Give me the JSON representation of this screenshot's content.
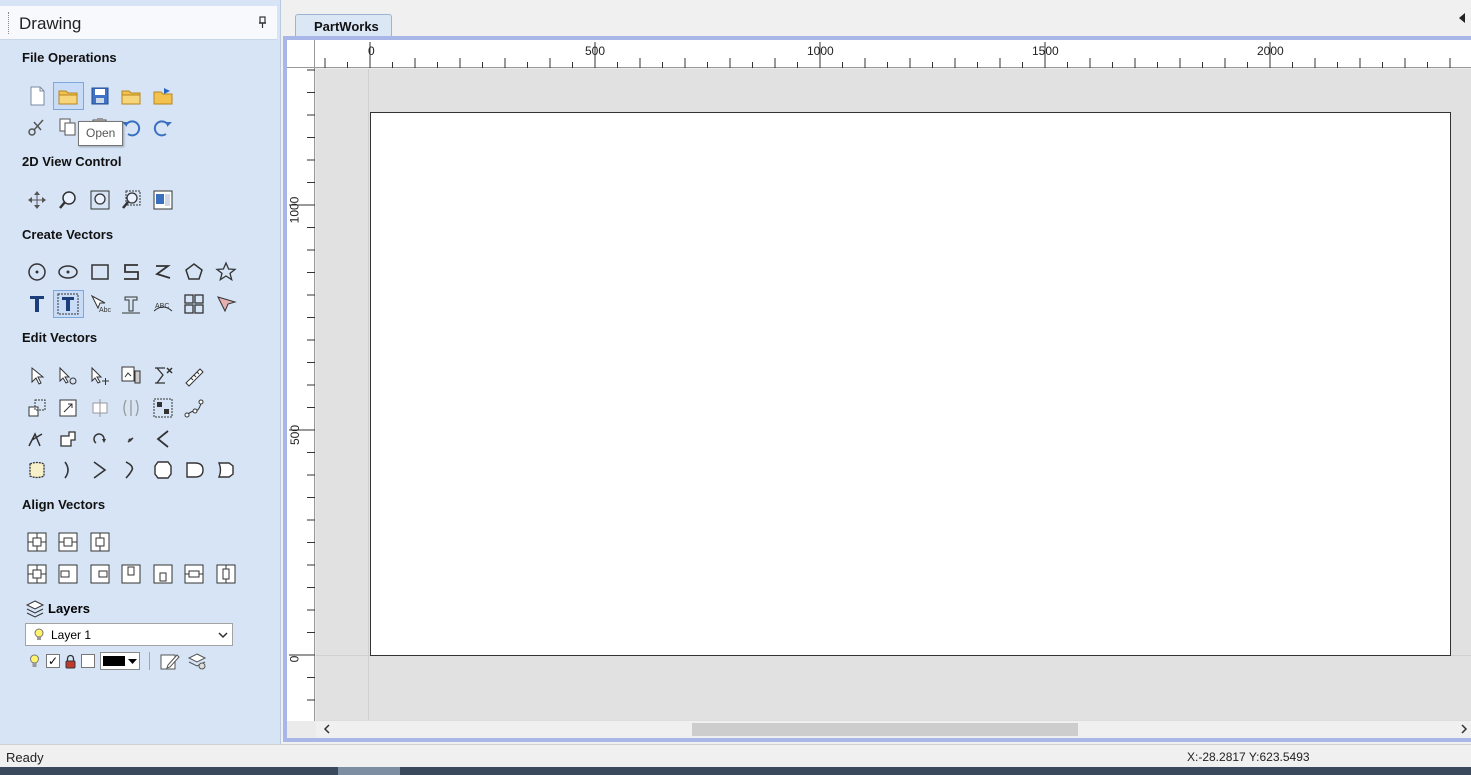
{
  "panel": {
    "title": "Drawing",
    "sections": {
      "file_operations": "File Operations",
      "view_control": "2D View Control",
      "create_vectors": "Create Vectors",
      "edit_vectors": "Edit Vectors",
      "align_vectors": "Align Vectors",
      "layers": "Layers"
    },
    "tooltip": "Open",
    "layer_select": {
      "selected": "Layer 1"
    }
  },
  "document": {
    "tab": "PartWorks",
    "ruler_top": [
      "0",
      "500",
      "1000",
      "1500",
      "2000"
    ],
    "ruler_left": [
      "1000",
      "500",
      "0"
    ]
  },
  "status": {
    "text": "Ready",
    "coords": "X:-28.2817 Y:623.5493"
  },
  "colors": {
    "panel_bg": "#d6e4f6",
    "frame_border": "#a8b6e8",
    "layer_color": "#000000"
  }
}
